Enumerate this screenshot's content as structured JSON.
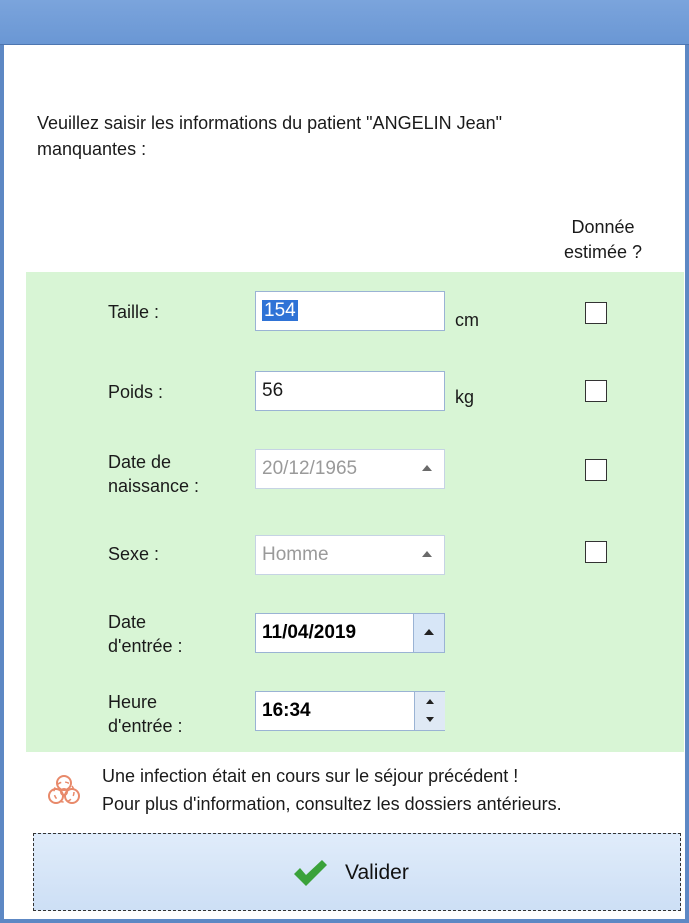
{
  "dialog": {
    "intro_line1": "Veuillez saisir les informations du patient \"ANGELIN Jean\"",
    "intro_line2": "manquantes :",
    "estimated_header_line1": "Donnée",
    "estimated_header_line2": "estimée ?"
  },
  "form": {
    "height": {
      "label": "Taille :",
      "value": "154",
      "unit": "cm",
      "estimated": false
    },
    "weight": {
      "label": "Poids :",
      "value": "56",
      "unit": "kg",
      "estimated": false
    },
    "birthdate": {
      "label_line1": "Date de",
      "label_line2": "naissance :",
      "value": "20/12/1965",
      "estimated": false
    },
    "sex": {
      "label": "Sexe :",
      "value": "Homme",
      "estimated": false
    },
    "entry_date": {
      "label_line1": "Date",
      "label_line2": "d'entrée :",
      "value": "11/04/2019"
    },
    "entry_time": {
      "label_line1": "Heure",
      "label_line2": "d'entrée :",
      "value": "16:34"
    }
  },
  "warning": {
    "icon": "biohazard-icon",
    "line1": "Une infection était en cours sur le séjour précédent !",
    "line2": "Pour plus d'information, consultez les dossiers antérieurs."
  },
  "validate_button": {
    "label": "Valider",
    "icon": "checkmark-icon"
  },
  "colors": {
    "titlebar": "#6a97d4",
    "form_background": "#d8f5d5",
    "selection": "#2f73d6",
    "button": "#d7e6f7",
    "checkmark": "#3aa23a",
    "biohazard": "#e8896a"
  }
}
